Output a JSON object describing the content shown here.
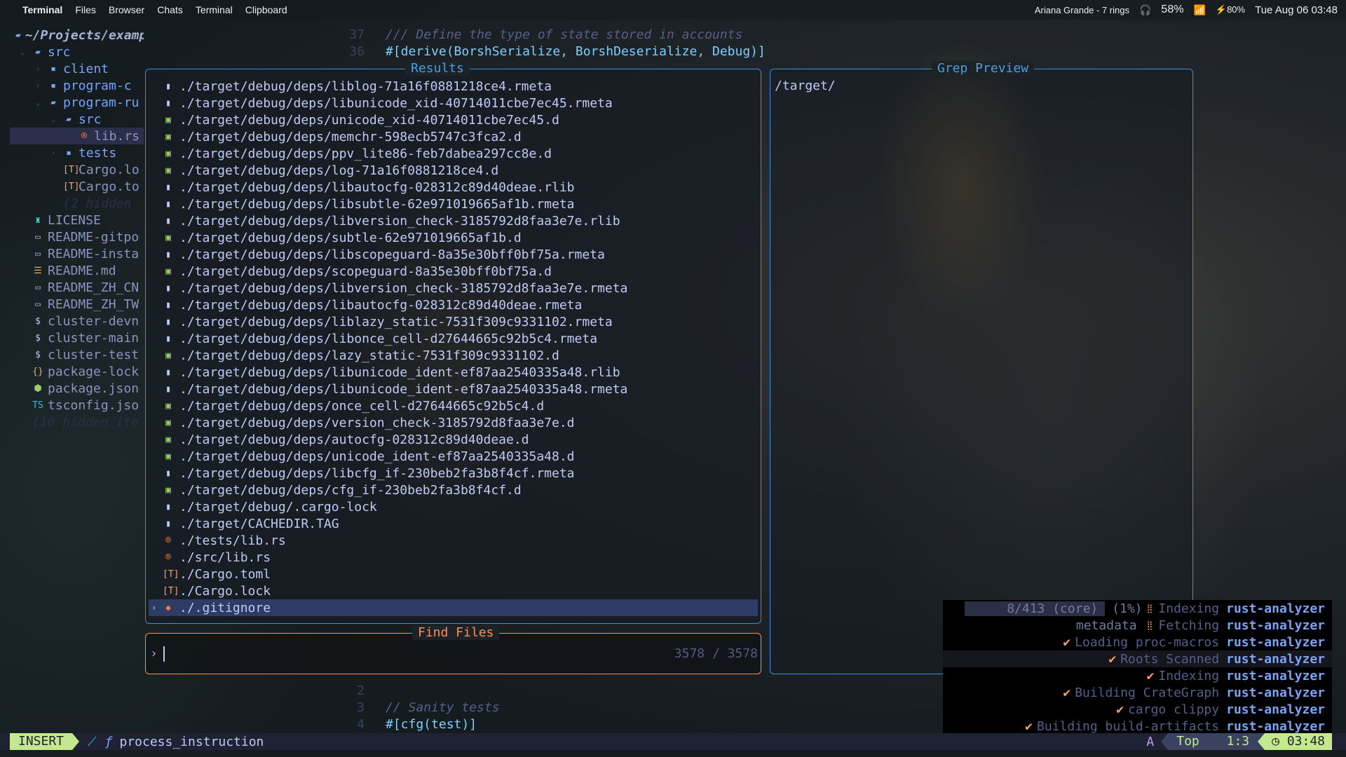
{
  "menubar": {
    "items": [
      "Terminal",
      "Files",
      "Browser",
      "Chats",
      "Terminal",
      "Clipboard"
    ],
    "now_playing": "Ariana Grande - 7 rings",
    "volume": "58%",
    "battery": "80%",
    "datetime": "Tue Aug 06 03:48"
  },
  "sidebar": {
    "root": "~/Projects/example-helloworld",
    "items": [
      {
        "label": "src",
        "icon": "folder-open",
        "depth": 0,
        "chev": "⌄"
      },
      {
        "label": "client",
        "icon": "folder",
        "depth": 1,
        "chev": "›"
      },
      {
        "label": "program-c",
        "icon": "folder",
        "depth": 1,
        "chev": "›"
      },
      {
        "label": "program-ru",
        "icon": "folder-open",
        "depth": 1,
        "chev": "⌄"
      },
      {
        "label": "src",
        "icon": "folder-open",
        "depth": 2,
        "chev": "⌄"
      },
      {
        "label": "lib.rs",
        "icon": "rust",
        "depth": 3,
        "chev": ""
      },
      {
        "label": "tests",
        "icon": "folder",
        "depth": 2,
        "chev": "›"
      },
      {
        "label": "Cargo.lo",
        "icon": "toml",
        "depth": 2,
        "chev": ""
      },
      {
        "label": "Cargo.to",
        "icon": "toml",
        "depth": 2,
        "chev": ""
      },
      {
        "label": "(2 hidden",
        "icon": "",
        "depth": 2,
        "chev": "",
        "hidden": true
      },
      {
        "label": "LICENSE",
        "icon": "license",
        "depth": 0,
        "chev": ""
      },
      {
        "label": "README-gitpo",
        "icon": "markdown",
        "depth": 0,
        "chev": ""
      },
      {
        "label": "README-insta",
        "icon": "markdown",
        "depth": 0,
        "chev": ""
      },
      {
        "label": "README.md",
        "icon": "readme",
        "depth": 0,
        "chev": ""
      },
      {
        "label": "README_ZH_CN",
        "icon": "markdown",
        "depth": 0,
        "chev": ""
      },
      {
        "label": "README_ZH_TW",
        "icon": "markdown",
        "depth": 0,
        "chev": ""
      },
      {
        "label": "cluster-devn",
        "icon": "shell",
        "depth": 0,
        "chev": ""
      },
      {
        "label": "cluster-main",
        "icon": "shell",
        "depth": 0,
        "chev": ""
      },
      {
        "label": "cluster-test",
        "icon": "shell",
        "depth": 0,
        "chev": ""
      },
      {
        "label": "package-lock",
        "icon": "json",
        "depth": 0,
        "chev": ""
      },
      {
        "label": "package.json",
        "icon": "nodejs",
        "depth": 0,
        "chev": ""
      },
      {
        "label": "tsconfig.jso",
        "icon": "typescript",
        "depth": 0,
        "chev": ""
      },
      {
        "label": "(10 hidden ite",
        "icon": "",
        "depth": 0,
        "chev": "",
        "hidden": true
      }
    ]
  },
  "code_top": [
    {
      "n": "37",
      "text": "/// Define the type of state stored in accounts",
      "comment": true
    },
    {
      "n": "36",
      "text": "#[derive(BorshSerialize, BorshDeserialize, Debug)]"
    }
  ],
  "code_bottom": [
    {
      "n": "2",
      "text": ""
    },
    {
      "n": "3",
      "text": "// Sanity tests",
      "comment": true
    },
    {
      "n": "4",
      "text": "#[cfg(test)]"
    }
  ],
  "results": {
    "title": "Results",
    "items": [
      {
        "path": "./target/debug/deps/liblog-71a16f0881218ce4.rmeta",
        "icon": "file"
      },
      {
        "path": "./target/debug/deps/libunicode_xid-40714011cbe7ec45.rmeta",
        "icon": "file"
      },
      {
        "path": "./target/debug/deps/unicode_xid-40714011cbe7ec45.d",
        "icon": "d-file"
      },
      {
        "path": "./target/debug/deps/memchr-598ecb5747c3fca2.d",
        "icon": "d-file"
      },
      {
        "path": "./target/debug/deps/ppv_lite86-feb7dabea297cc8e.d",
        "icon": "d-file"
      },
      {
        "path": "./target/debug/deps/log-71a16f0881218ce4.d",
        "icon": "d-file"
      },
      {
        "path": "./target/debug/deps/libautocfg-028312c89d40deae.rlib",
        "icon": "file"
      },
      {
        "path": "./target/debug/deps/libsubtle-62e971019665af1b.rmeta",
        "icon": "file"
      },
      {
        "path": "./target/debug/deps/libversion_check-3185792d8faa3e7e.rlib",
        "icon": "file"
      },
      {
        "path": "./target/debug/deps/subtle-62e971019665af1b.d",
        "icon": "d-file"
      },
      {
        "path": "./target/debug/deps/libscopeguard-8a35e30bff0bf75a.rmeta",
        "icon": "file"
      },
      {
        "path": "./target/debug/deps/scopeguard-8a35e30bff0bf75a.d",
        "icon": "d-file"
      },
      {
        "path": "./target/debug/deps/libversion_check-3185792d8faa3e7e.rmeta",
        "icon": "file"
      },
      {
        "path": "./target/debug/deps/libautocfg-028312c89d40deae.rmeta",
        "icon": "file"
      },
      {
        "path": "./target/debug/deps/liblazy_static-7531f309c9331102.rmeta",
        "icon": "file"
      },
      {
        "path": "./target/debug/deps/libonce_cell-d27644665c92b5c4.rmeta",
        "icon": "file"
      },
      {
        "path": "./target/debug/deps/lazy_static-7531f309c9331102.d",
        "icon": "d-file"
      },
      {
        "path": "./target/debug/deps/libunicode_ident-ef87aa2540335a48.rlib",
        "icon": "file"
      },
      {
        "path": "./target/debug/deps/libunicode_ident-ef87aa2540335a48.rmeta",
        "icon": "file"
      },
      {
        "path": "./target/debug/deps/once_cell-d27644665c92b5c4.d",
        "icon": "d-file"
      },
      {
        "path": "./target/debug/deps/version_check-3185792d8faa3e7e.d",
        "icon": "d-file"
      },
      {
        "path": "./target/debug/deps/autocfg-028312c89d40deae.d",
        "icon": "d-file"
      },
      {
        "path": "./target/debug/deps/unicode_ident-ef87aa2540335a48.d",
        "icon": "d-file"
      },
      {
        "path": "./target/debug/deps/libcfg_if-230beb2fa3b8f4cf.rmeta",
        "icon": "file"
      },
      {
        "path": "./target/debug/deps/cfg_if-230beb2fa3b8f4cf.d",
        "icon": "d-file"
      },
      {
        "path": "./target/debug/.cargo-lock",
        "icon": "file"
      },
      {
        "path": "./target/CACHEDIR.TAG",
        "icon": "file"
      },
      {
        "path": "./tests/lib.rs",
        "icon": "rust"
      },
      {
        "path": "./src/lib.rs",
        "icon": "rust"
      },
      {
        "path": "./Cargo.toml",
        "icon": "toml"
      },
      {
        "path": "./Cargo.lock",
        "icon": "toml"
      },
      {
        "path": "./.gitignore",
        "icon": "git",
        "selected": true
      }
    ]
  },
  "grep": {
    "title": "Grep Preview",
    "path": "/target/"
  },
  "find": {
    "title": "Find Files",
    "prompt": "›",
    "count": "3578 / 3578"
  },
  "lsp": [
    {
      "pre": "8/413 (core)",
      "pct": "(1%)",
      "spin": true,
      "msg": "Indexing",
      "src": "rust-analyzer",
      "hl": true
    },
    {
      "pre": "metadata",
      "spin": true,
      "msg": "Fetching",
      "src": "rust-analyzer"
    },
    {
      "msg": "Loading proc-macros",
      "src": "rust-analyzer",
      "done": true
    },
    {
      "msg": "Roots Scanned",
      "src": "rust-analyzer",
      "done": true,
      "rowhl": true
    },
    {
      "msg": "Indexing",
      "src": "rust-analyzer",
      "done": true
    },
    {
      "msg": "Building CrateGraph",
      "src": "rust-analyzer",
      "done": true
    },
    {
      "msg": "cargo clippy",
      "src": "rust-analyzer",
      "done": true
    },
    {
      "msg": "Building build-artifacts",
      "src": "rust-analyzer",
      "done": true
    }
  ],
  "statusline": {
    "mode": "INSERT",
    "symbol": "process_instruction",
    "a": "A",
    "position": "Top",
    "cursor": "1:3",
    "time": "03:48"
  },
  "colors": {
    "accent": "#3d8fd6",
    "find": "#ff8f5a",
    "mode": "#c3e88d",
    "selection": "#2e3c64"
  }
}
